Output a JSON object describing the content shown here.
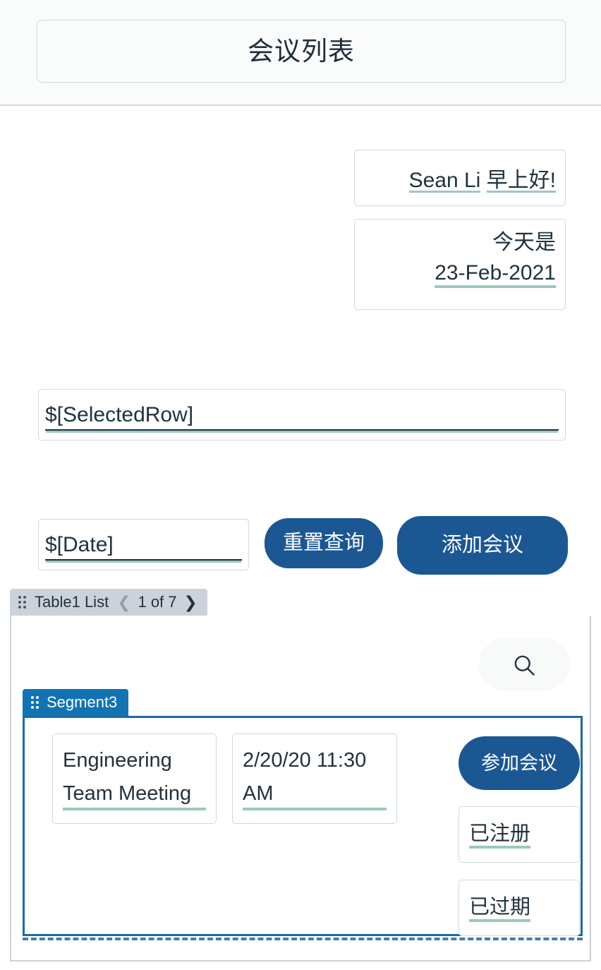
{
  "header": {
    "title": "会议列表"
  },
  "greeting": {
    "user_name": "Sean Li",
    "salutation": "早上好!"
  },
  "today": {
    "label": "今天是",
    "date": "23-Feb-2021"
  },
  "selected_row": {
    "value": "$[SelectedRow]"
  },
  "filters": {
    "date_value": "$[Date]",
    "reset_label": "重置查询",
    "add_meeting_label": "添加会议"
  },
  "list": {
    "tab_label": "Table1 List",
    "drag_handle_icon": "drag-dots-icon",
    "prev_icon": "chevron-left-icon",
    "next_icon": "chevron-right-icon",
    "page_indicator": "1 of 7",
    "search_icon": "search-icon"
  },
  "segment": {
    "tab_label": "Segment3",
    "drag_handle_icon": "drag-dots-icon"
  },
  "row": {
    "meeting_title": "Engineering Team Meeting",
    "meeting_datetime": "2/20/20 11:30 AM",
    "join_label": "参加会议",
    "registered_label": "已注册",
    "expired_label": "已过期"
  },
  "colors": {
    "primary_blue": "#1b5793",
    "segment_blue": "#1273b3",
    "segment_border_blue": "#1b6ba5",
    "dynamic_underline_teal": "#9bc9bd",
    "tab_gray": "#ccd2d9",
    "text_dark": "#21323d",
    "border_gray": "#d2d7dc",
    "header_bg": "#fafbfb"
  }
}
